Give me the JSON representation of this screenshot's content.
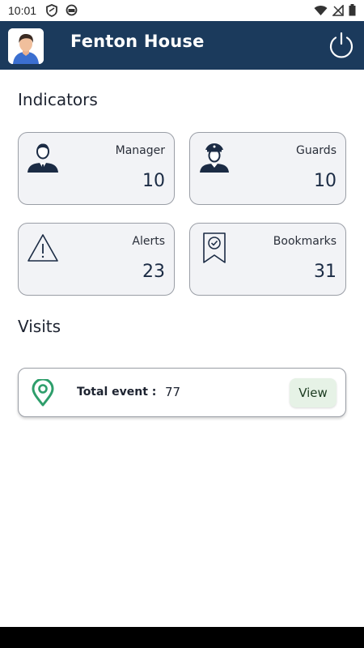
{
  "status_bar": {
    "time": "10:01",
    "left_icons": [
      "shield-icon",
      "circle-app-icon"
    ],
    "right_icons": [
      "wifi-icon",
      "cellular-off-icon",
      "battery-icon"
    ]
  },
  "app_bar": {
    "title": "Fenton House",
    "background": "#1b3a5c",
    "avatar_icon": "user-avatar-icon",
    "power_icon": "power-icon"
  },
  "indicators": {
    "title": "Indicators",
    "cards": [
      {
        "label": "Manager",
        "value": "10",
        "icon": "manager-icon"
      },
      {
        "label": "Guards",
        "value": "10",
        "icon": "guard-icon"
      },
      {
        "label": "Alerts",
        "value": "23",
        "icon": "warning-icon"
      },
      {
        "label": "Bookmarks",
        "value": "31",
        "icon": "bookmark-check-icon"
      }
    ]
  },
  "visits": {
    "title": "Visits",
    "event_label": "Total event :",
    "event_value": "77",
    "view_label": "View",
    "pin_icon": "location-pin-icon",
    "accent": "#2e9e6b"
  }
}
